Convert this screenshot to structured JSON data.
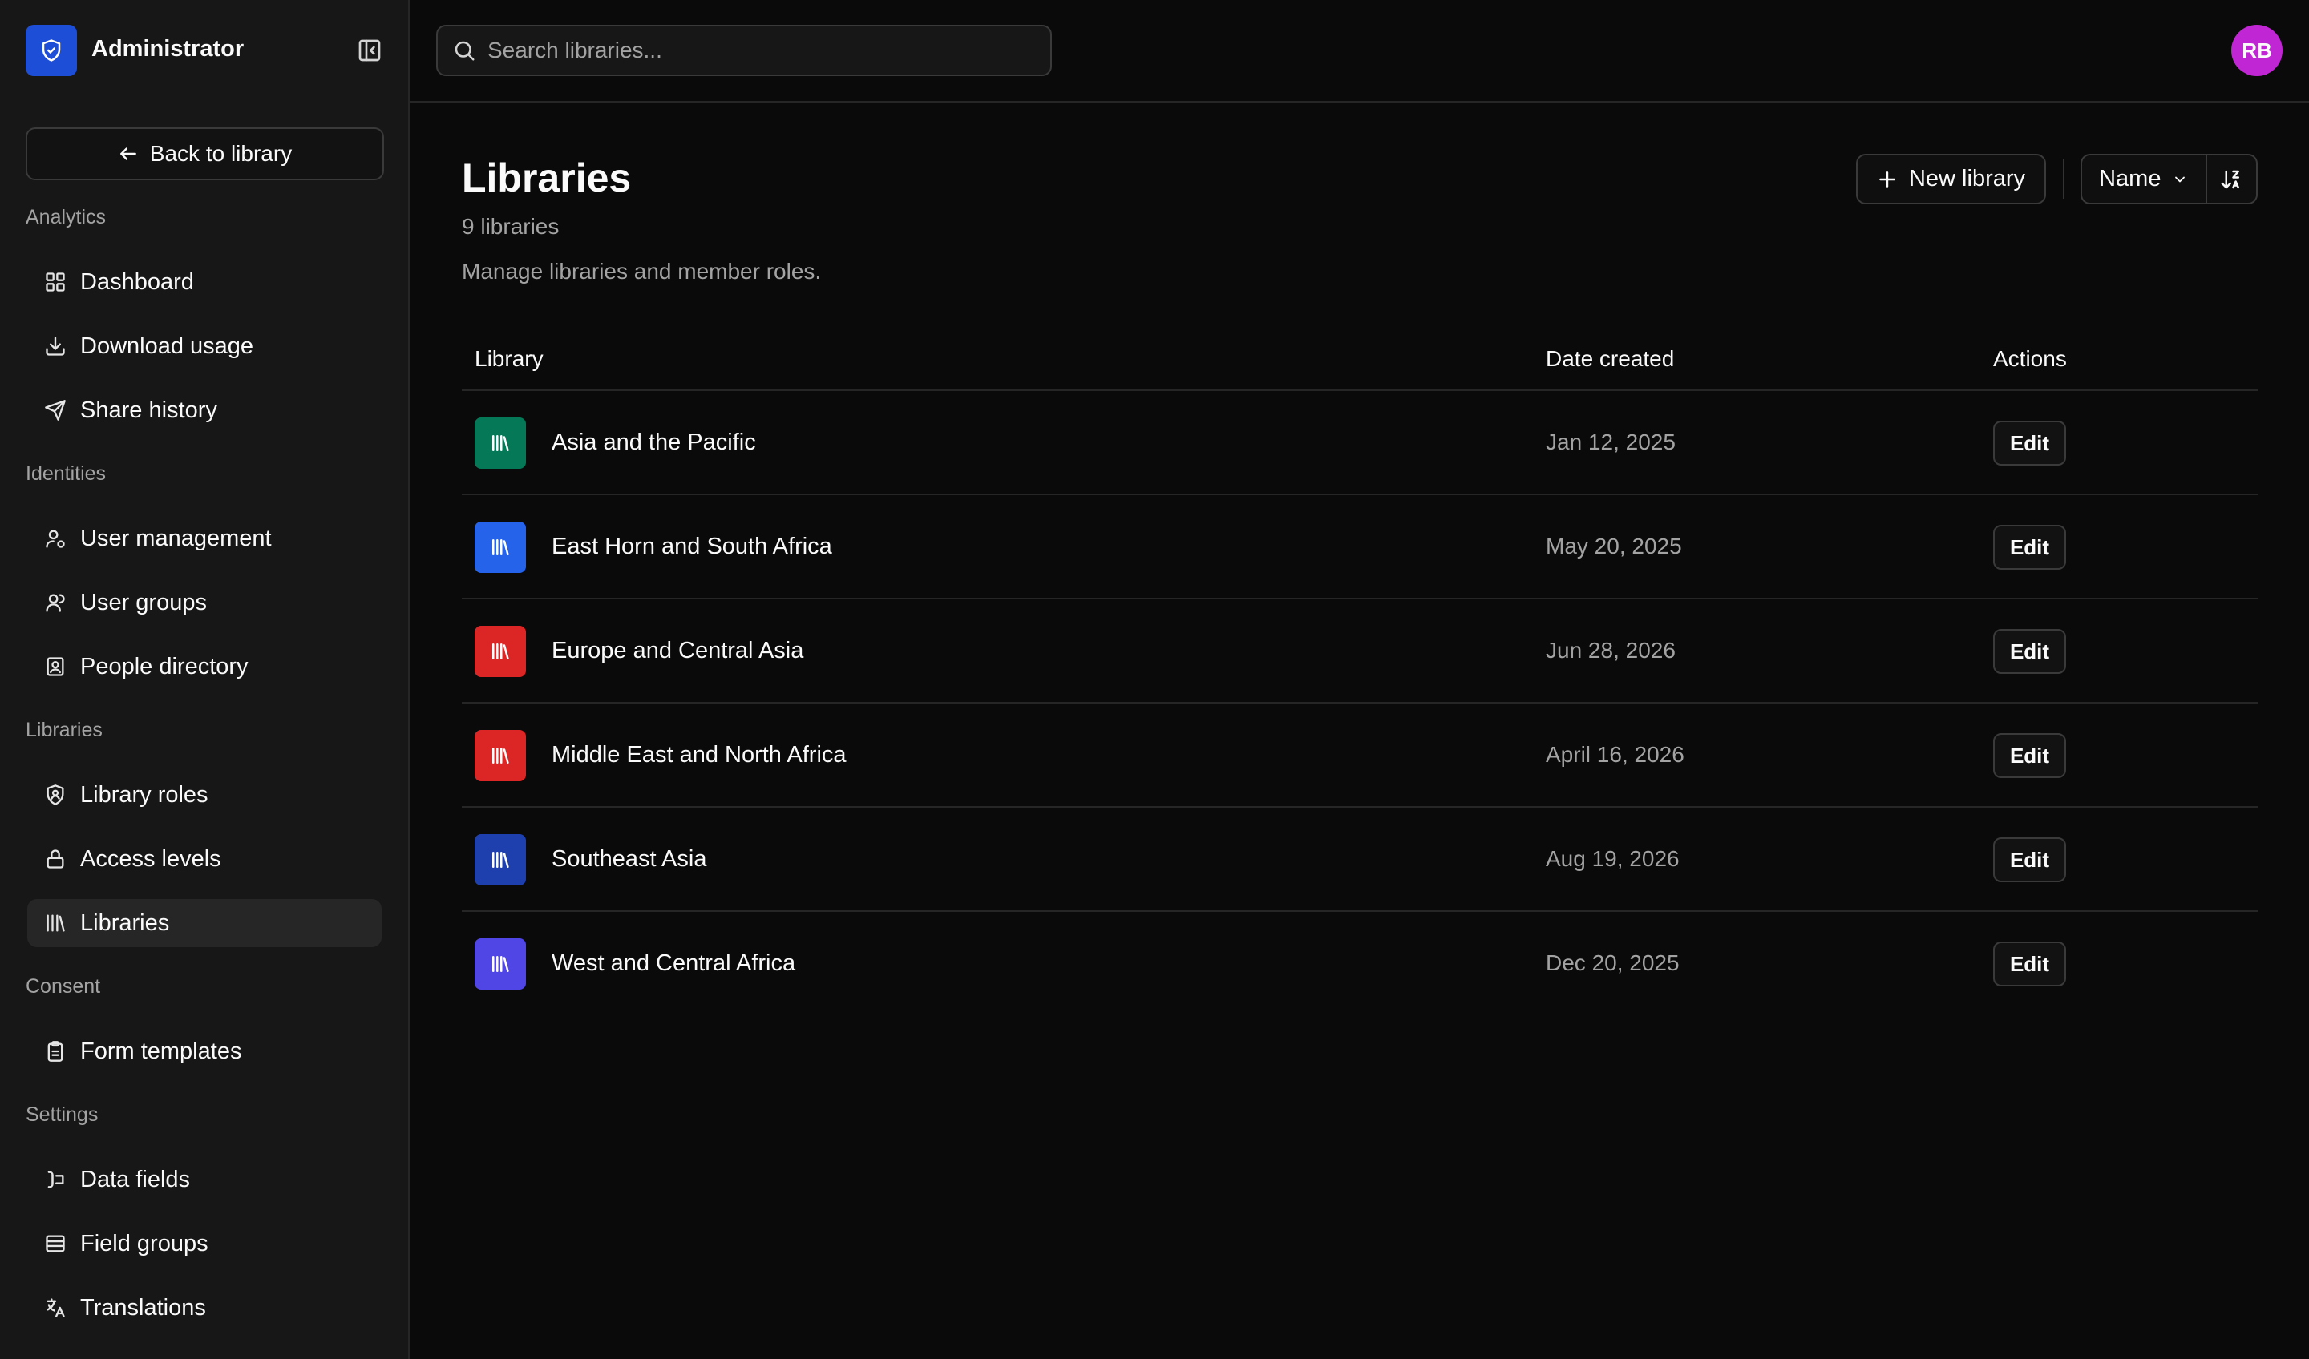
{
  "sidebar": {
    "brand": "Administrator",
    "back_label": "Back to library",
    "sections": {
      "analytics": "Analytics",
      "identities": "Identities",
      "libraries": "Libraries",
      "consent": "Consent",
      "settings": "Settings"
    },
    "items": {
      "dashboard": "Dashboard",
      "download_usage": "Download usage",
      "share_history": "Share history",
      "user_management": "User management",
      "user_groups": "User groups",
      "people_directory": "People directory",
      "library_roles": "Library roles",
      "access_levels": "Access levels",
      "libraries": "Libraries",
      "form_templates": "Form templates",
      "data_fields": "Data fields",
      "field_groups": "Field groups",
      "translations": "Translations"
    }
  },
  "topbar": {
    "search_placeholder": "Search libraries...",
    "avatar_initials": "RB"
  },
  "main": {
    "title": "Libraries",
    "count": "9 libraries",
    "description": "Manage libraries and member roles.",
    "new_label": "New library",
    "sort_label": "Name",
    "columns": {
      "library": "Library",
      "date_created": "Date created",
      "actions": "Actions"
    },
    "edit_label": "Edit",
    "rows": [
      {
        "name": "Asia and the Pacific",
        "date": "Jan 12, 2025",
        "color": "#047857"
      },
      {
        "name": "East Horn and South Africa",
        "date": "May 20, 2025",
        "color": "#2563eb"
      },
      {
        "name": "Europe and Central Asia",
        "date": "Jun 28, 2026",
        "color": "#dc2626"
      },
      {
        "name": "Middle East and North Africa",
        "date": "April 16, 2026",
        "color": "#dc2626"
      },
      {
        "name": "Southeast Asia",
        "date": "Aug 19, 2026",
        "color": "#1e40af"
      },
      {
        "name": "West and Central Africa",
        "date": "Dec 20, 2025",
        "color": "#4f46e5"
      }
    ]
  },
  "colors": {
    "brand": "#1d4ed8",
    "avatar": "#c026d3",
    "background": "#0a0a0a",
    "sidebar": "#171717"
  }
}
